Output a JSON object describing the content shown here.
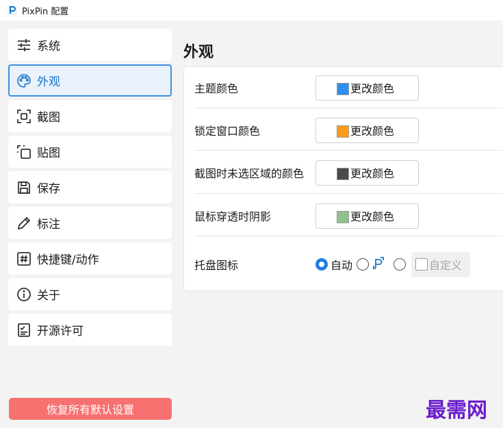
{
  "window": {
    "title": "PixPin 配置",
    "logo_icon": "pixpin-logo-icon"
  },
  "colors": {
    "accent": "#3c8ee0",
    "reset_button": "#f87171",
    "watermark": "#6a1ccc"
  },
  "sidebar": {
    "items": [
      {
        "label": "系统",
        "icon": "sliders-icon",
        "active": false
      },
      {
        "label": "外观",
        "icon": "palette-icon",
        "active": true
      },
      {
        "label": "截图",
        "icon": "screenshot-icon",
        "active": false
      },
      {
        "label": "贴图",
        "icon": "pin-image-icon",
        "active": false
      },
      {
        "label": "保存",
        "icon": "save-icon",
        "active": false
      },
      {
        "label": "标注",
        "icon": "pencil-icon",
        "active": false
      },
      {
        "label": "快捷键/动作",
        "icon": "hashtag-icon",
        "active": false
      },
      {
        "label": "关于",
        "icon": "info-icon",
        "active": false
      },
      {
        "label": "开源许可",
        "icon": "license-icon",
        "active": false
      }
    ],
    "reset_label": "恢复所有默认设置"
  },
  "main": {
    "title": "外观",
    "settings": [
      {
        "label": "主题颜色",
        "button_label": "更改颜色",
        "swatch": "#2f8ff0"
      },
      {
        "label": "锁定窗口颜色",
        "button_label": "更改颜色",
        "swatch": "#ff9c1a"
      },
      {
        "label": "截图时未选区域的颜色",
        "button_label": "更改颜色",
        "swatch": "#4a4a4a"
      },
      {
        "label": "鼠标穿透时阴影",
        "button_label": "更改颜色",
        "swatch": "#8fc28a"
      }
    ],
    "tray": {
      "label": "托盘图标",
      "options": [
        {
          "label": "自动",
          "checked": true
        },
        {
          "icon": "pixpin-p-icon",
          "checked": false
        },
        {
          "label": "",
          "checked": false
        }
      ],
      "custom_label": "自定义"
    }
  },
  "watermark": "最需网"
}
